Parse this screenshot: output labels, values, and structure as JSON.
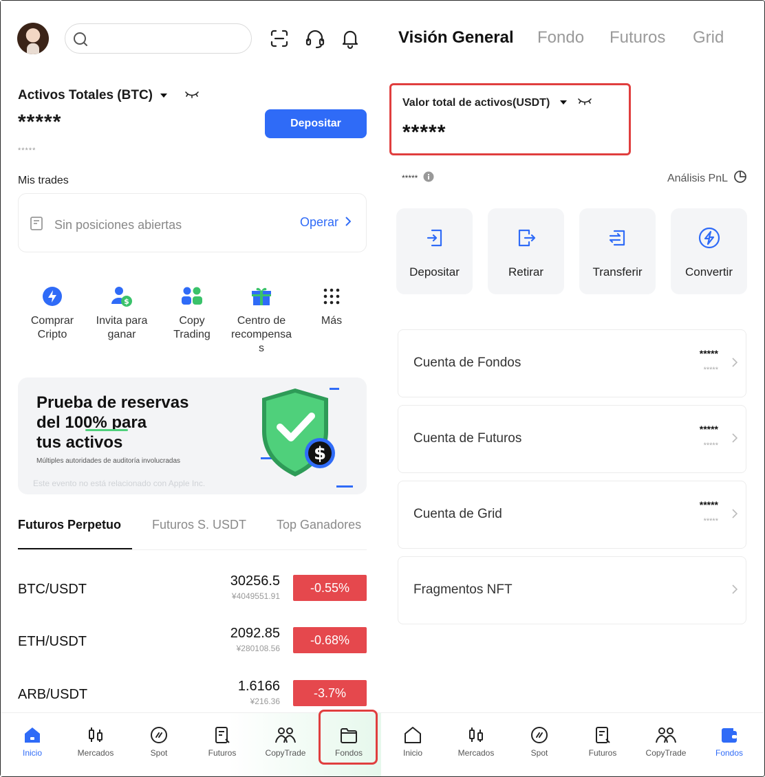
{
  "left": {
    "header": {
      "search_placeholder": ""
    },
    "assets": {
      "label": "Activos Totales (BTC)",
      "value": "*****",
      "sub_value": "*****",
      "deposit_button": "Depositar"
    },
    "trades": {
      "title": "Mis trades",
      "empty_text": "Sin posiciones abiertas",
      "action": "Operar"
    },
    "quick_actions": [
      {
        "label": "Comprar\nCripto",
        "icon": "lightning-icon"
      },
      {
        "label": "Invita para\nganar",
        "icon": "invite-user-icon"
      },
      {
        "label": "Copy\nTrading",
        "icon": "copy-trading-icon"
      },
      {
        "label": "Centro de\nrecompensa\ns",
        "icon": "gift-icon"
      },
      {
        "label": "Más",
        "icon": "grid-dots-icon"
      }
    ],
    "banner": {
      "title": "Prueba de reservas\ndel 100% para\ntus activos",
      "subtitle": "Múltiples autoridades de auditoría involucradas",
      "disclaimer": "Este evento no está relacionado con Apple Inc."
    },
    "market_tabs": [
      "Futuros Perpetuo",
      "Futuros S. USDT",
      "Top Ganadores"
    ],
    "market_rows": [
      {
        "pair": "BTC/USDT",
        "price": "30256.5",
        "fiat": "¥4049551.91",
        "change": "-0.55%"
      },
      {
        "pair": "ETH/USDT",
        "price": "2092.85",
        "fiat": "¥280108.56",
        "change": "-0.68%"
      },
      {
        "pair": "ARB/USDT",
        "price": "1.6166",
        "fiat": "¥216.36",
        "change": "-3.7%"
      }
    ],
    "nav": [
      "Inicio",
      "Mercados",
      "Spot",
      "Futuros",
      "CopyTrade",
      "Fondos"
    ]
  },
  "right": {
    "tabs": [
      "Visión General",
      "Fondo",
      "Futuros",
      "Grid"
    ],
    "total": {
      "label": "Valor total de activos(USDT)",
      "value": "*****"
    },
    "sub_value": "*****",
    "pnl": "Análisis PnL",
    "actions": [
      "Depositar",
      "Retirar",
      "Transferir",
      "Convertir"
    ],
    "accounts": [
      {
        "name": "Cuenta de Fondos",
        "v1": "*****",
        "v2": "*****"
      },
      {
        "name": "Cuenta de Futuros",
        "v1": "*****",
        "v2": "*****"
      },
      {
        "name": "Cuenta de Grid",
        "v1": "*****",
        "v2": "*****"
      },
      {
        "name": "Fragmentos NFT",
        "v1": "",
        "v2": ""
      }
    ],
    "nav": [
      "Inicio",
      "Mercados",
      "Spot",
      "Futuros",
      "CopyTrade",
      "Fondos"
    ]
  },
  "colors": {
    "accent": "#2f6bf7",
    "negative": "#e5484d",
    "highlight": "#e03e3e"
  }
}
